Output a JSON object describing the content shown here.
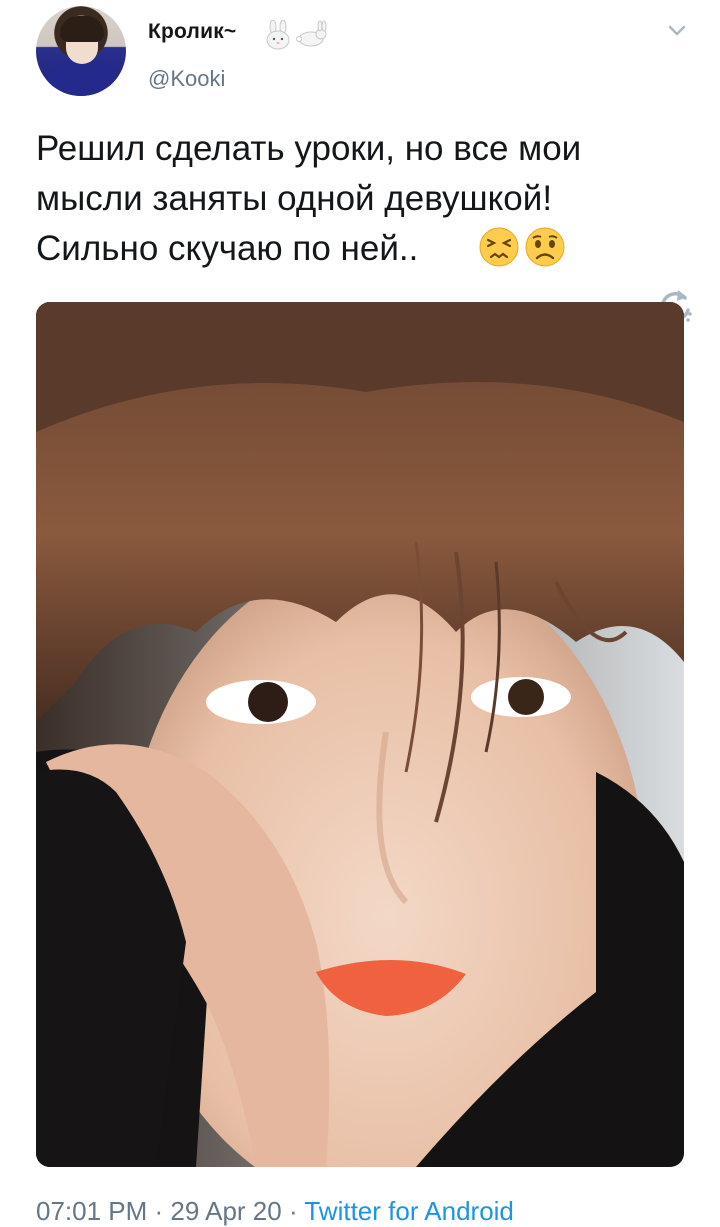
{
  "tweet": {
    "display_name": "Кролик~",
    "name_emojis": [
      "rabbit-face-icon",
      "rabbit-icon"
    ],
    "handle": "@Kooki",
    "text_line1": "Решил сделать уроки, но все мои",
    "text_line2": "мысли заняты одной девушкой!",
    "text_line3": "Сильно скучаю по ней..",
    "text_emojis": [
      "persevering-face-icon",
      "worried-face-icon"
    ],
    "time": "07:01 PM",
    "separator": " · ",
    "date": "29 Apr 20",
    "source": "Twitter for Android"
  },
  "colors": {
    "text": "#14171a",
    "secondary": "#657786",
    "link": "#1b95e0"
  }
}
